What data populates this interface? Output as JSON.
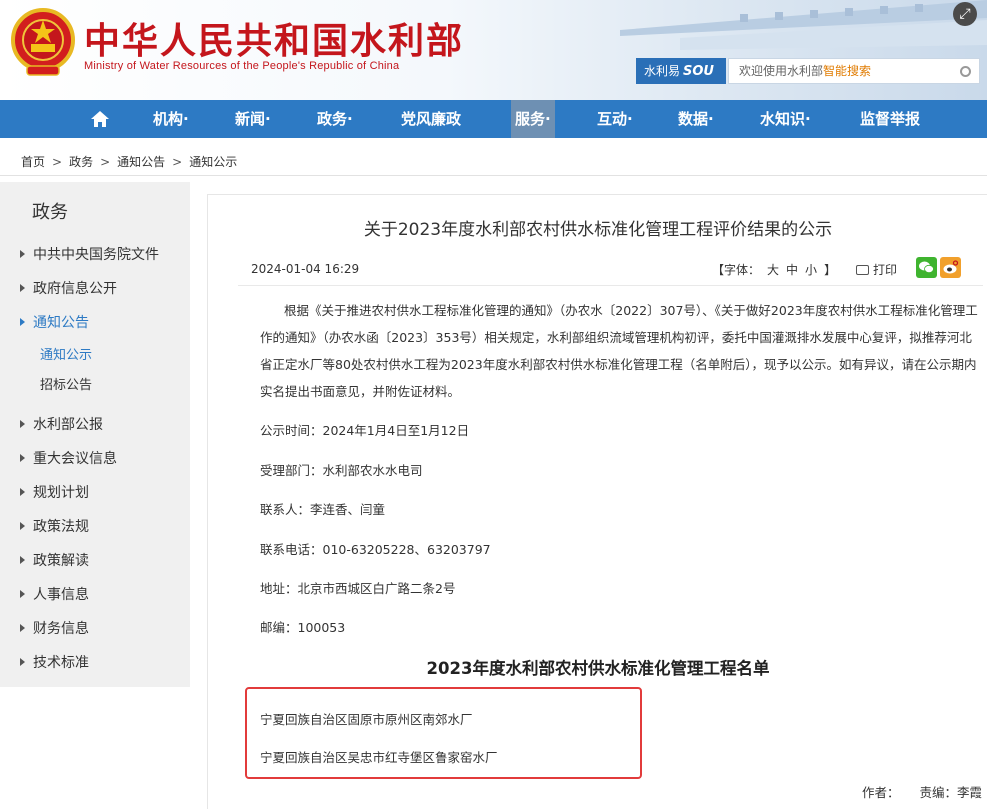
{
  "header": {
    "title": "中华人民共和国水利部",
    "subtitle": "Ministry of Water Resources of the People's Republic of China"
  },
  "search": {
    "brand_prefix": "水利易",
    "brand_suffix": "SOU",
    "placeholder_plain": "欢迎使用水利部",
    "placeholder_highlight": "智能搜索"
  },
  "nav": {
    "items": [
      {
        "label": "机构"
      },
      {
        "label": "新闻"
      },
      {
        "label": "政务"
      },
      {
        "label": "党风廉政"
      },
      {
        "label": "服务"
      },
      {
        "label": "互动"
      },
      {
        "label": "数据"
      },
      {
        "label": "水知识"
      },
      {
        "label": "监督举报"
      }
    ],
    "active": "服务"
  },
  "breadcrumb": [
    "首页",
    "政务",
    "通知公告",
    "通知公示"
  ],
  "sidebar": {
    "title": "政务",
    "items": [
      {
        "label": "中共中央国务院文件"
      },
      {
        "label": "政府信息公开"
      },
      {
        "label": "通知公告"
      },
      {
        "label": "水利部公报"
      },
      {
        "label": "重大会议信息"
      },
      {
        "label": "规划计划"
      },
      {
        "label": "政策法规"
      },
      {
        "label": "政策解读"
      },
      {
        "label": "人事信息"
      },
      {
        "label": "财务信息"
      },
      {
        "label": "技术标准"
      }
    ],
    "sub_items": [
      {
        "label": "通知公示"
      },
      {
        "label": "招标公告"
      }
    ]
  },
  "article": {
    "title": "关于2023年度水利部农村供水标准化管理工程评价结果的公示",
    "date": "2024-01-04 16:29",
    "font_label": "【字体：",
    "font_sizes": [
      "大",
      "中",
      "小"
    ],
    "font_close": "】",
    "print_label": "打印",
    "body": "根据《关于推进农村供水工程标准化管理的通知》（办农水〔2022〕307号）、《关于做好2023年度农村供水工程标准化管理工作的通知》（办农水函〔2023〕353号）相关规定，水利部组织流域管理机构初评，委托中国灌溉排水发展中心复评，拟推荐河北省正定水厂等80处农村供水工程为2023年度水利部农村供水标准化管理工程（名单附后），现予以公示。如有异议，请在公示期内实名提出书面意见，并附佐证材料。",
    "period": "公示时间：2024年1月4日至1月12日",
    "department": "受理部门：水利部农水水电司",
    "contact": "联系人：李连香、闫童",
    "phone": "联系电话：010-63205228、63203797",
    "address": "地址：北京市西城区白广路二条2号",
    "postcode": "邮编：100053",
    "list_title": "2023年度水利部农村供水标准化管理工程名单",
    "list": [
      "宁夏回族自治区固原市原州区南郊水厂",
      "宁夏回族自治区吴忠市红寺堡区鲁家窑水厂"
    ],
    "author": "作者：",
    "editor": "责编：李霞"
  }
}
